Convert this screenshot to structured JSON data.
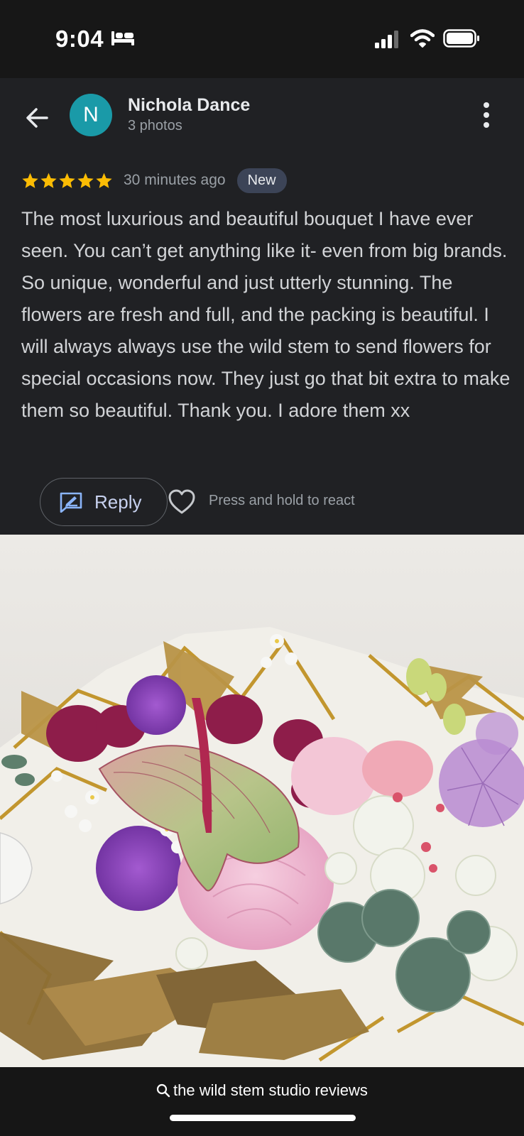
{
  "status_bar": {
    "time": "9:04",
    "icons": [
      "bed-icon",
      "signal-icon",
      "wifi-icon",
      "battery-icon"
    ]
  },
  "review": {
    "reviewer": {
      "initial": "N",
      "name": "Nichola Dance",
      "photo_count": "3 photos",
      "avatar_color": "#1a9aa8"
    },
    "rating": 5,
    "time_ago": "30 minutes ago",
    "badge": "New",
    "text": "The most luxurious and beautiful bouquet I have ever seen. You can’t get anything like it- even from big brands. So unique, wonderful and just utterly stunning. The flowers are fresh and full, and the packing is beautiful. I will always always use the wild stem to send flowers for special occasions now. They just go that bit extra to make them so beautiful. Thank you. I adore them xx",
    "actions": {
      "reply_label": "Reply",
      "react_hint": "Press and hold to react"
    }
  },
  "photo": {
    "subject": "flower-bouquet-photo"
  },
  "bottom_bar": {
    "search_query": "the wild stem studio reviews"
  },
  "colors": {
    "background": "#202124",
    "status_bar": "#171717",
    "star": "#fbbc04",
    "badge_bg": "#3c4457",
    "accent": "#8ab4f8"
  }
}
